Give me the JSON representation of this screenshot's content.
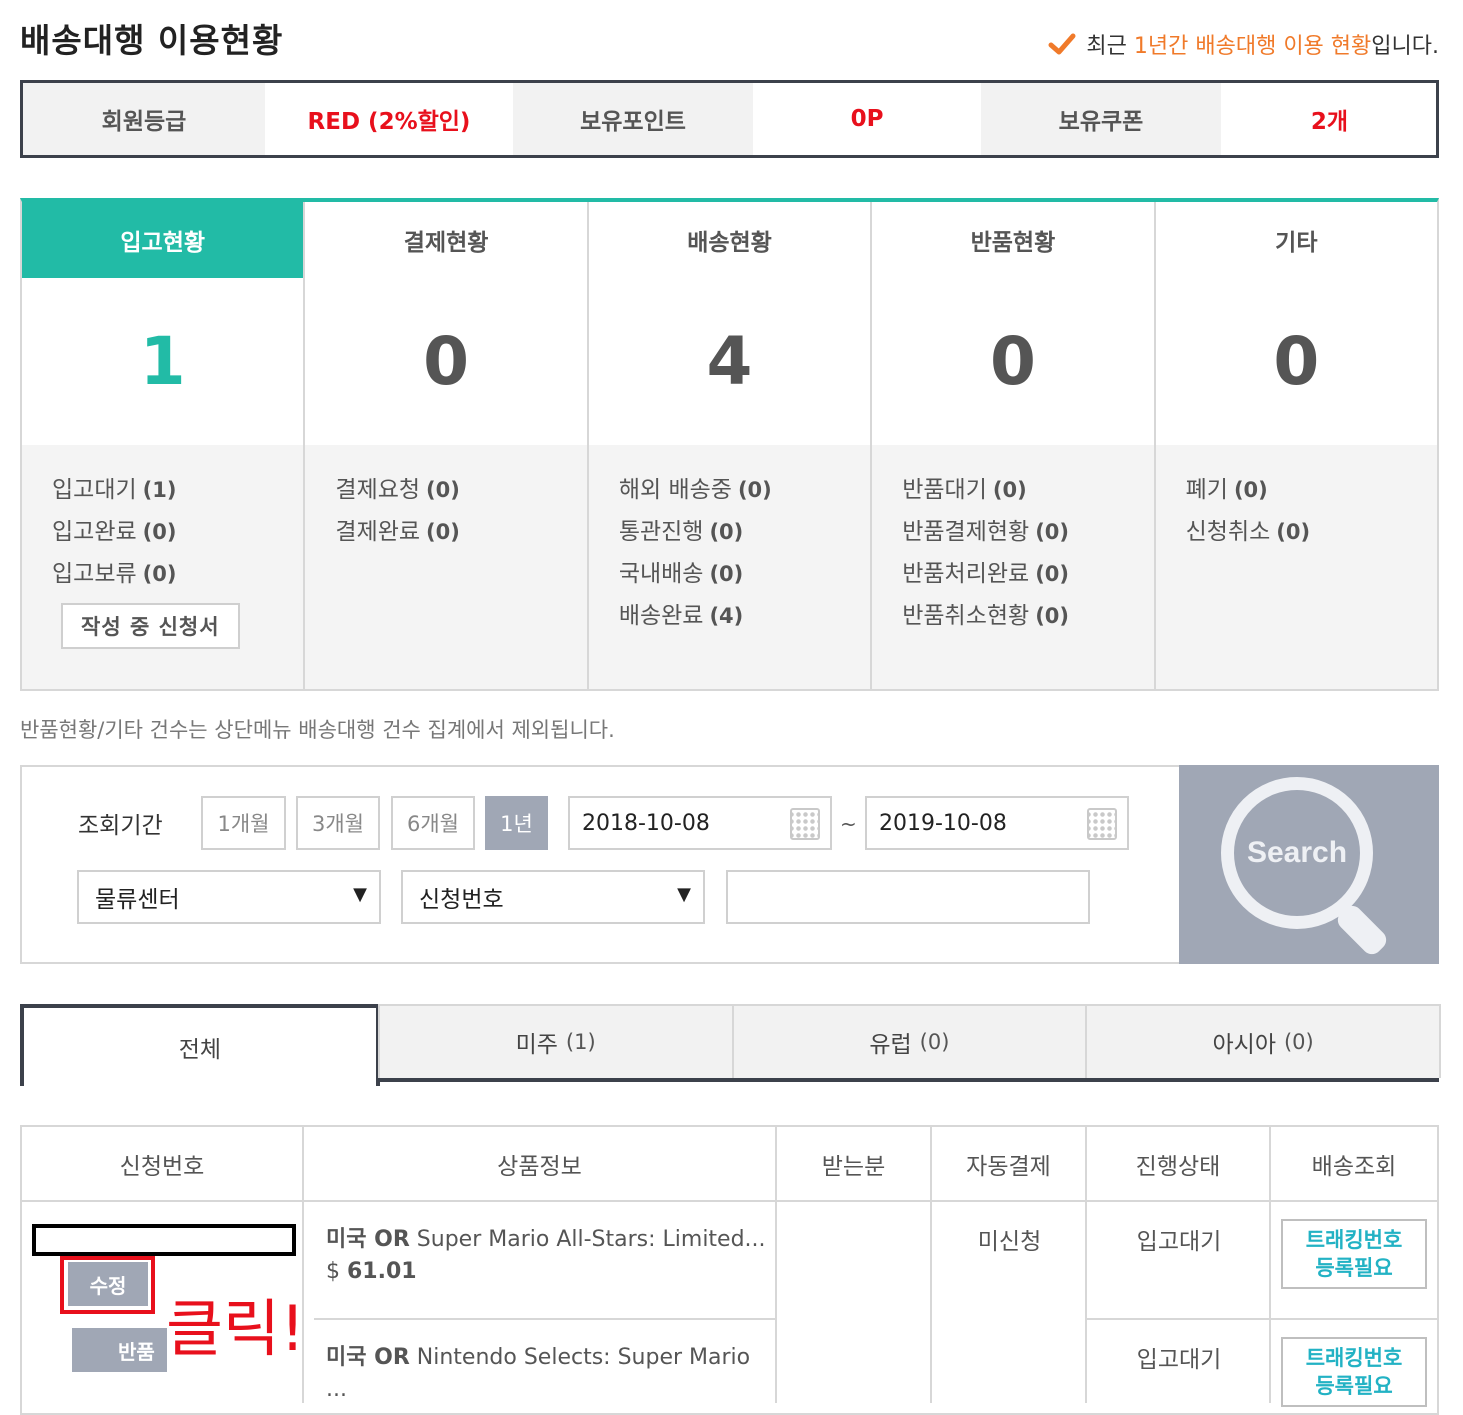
{
  "header": {
    "title": "배송대행 이용현황",
    "notice_prefix": "최근 ",
    "notice_highlight": "1년간 배송대행 이용 현황",
    "notice_suffix": "입니다."
  },
  "member": {
    "grade_label": "회원등급",
    "grade_value": "RED (2%할인)",
    "points_label": "보유포인트",
    "points_value": "0P",
    "coupons_label": "보유쿠폰",
    "coupons_value": "2개"
  },
  "status": {
    "columns": [
      {
        "title": "입고현황",
        "count": "1",
        "items": [
          {
            "label": "입고대기",
            "count": "(1)"
          },
          {
            "label": "입고완료",
            "count": "(0)"
          },
          {
            "label": "입고보류",
            "count": "(0)"
          }
        ]
      },
      {
        "title": "결제현황",
        "count": "0",
        "items": [
          {
            "label": "결제요청",
            "count": "(0)"
          },
          {
            "label": "결제완료",
            "count": "(0)"
          }
        ]
      },
      {
        "title": "배송현황",
        "count": "4",
        "items": [
          {
            "label": "해외 배송중",
            "count": "(0)"
          },
          {
            "label": "통관진행",
            "count": "(0)"
          },
          {
            "label": "국내배송",
            "count": "(0)"
          },
          {
            "label": "배송완료",
            "count": "(4)"
          }
        ]
      },
      {
        "title": "반품현황",
        "count": "0",
        "items": [
          {
            "label": "반품대기",
            "count": "(0)"
          },
          {
            "label": "반품결제현황",
            "count": "(0)"
          },
          {
            "label": "반품처리완료",
            "count": "(0)"
          },
          {
            "label": "반품취소현황",
            "count": "(0)"
          }
        ]
      },
      {
        "title": "기타",
        "count": "0",
        "items": [
          {
            "label": "폐기",
            "count": "(0)"
          },
          {
            "label": "신청취소",
            "count": "(0)"
          }
        ]
      }
    ],
    "draft_button": "작성 중 신청서",
    "footnote": "반품현황/기타 건수는 상단메뉴 배송대행 건수 집계에서 제외됩니다."
  },
  "search": {
    "period_label": "조회기간",
    "period_buttons": [
      "1개월",
      "3개월",
      "6개월",
      "1년"
    ],
    "active_period": "1년",
    "date_from": "2018-10-08",
    "date_sep": "~",
    "date_to": "2019-10-08",
    "center_select": "물류센터",
    "field_select": "신청번호",
    "keyword": "",
    "search_button": "Search"
  },
  "tabs": [
    {
      "label": "전체",
      "count": ""
    },
    {
      "label": "미주",
      "count": "(1)"
    },
    {
      "label": "유럽",
      "count": "(0)"
    },
    {
      "label": "아시아",
      "count": "(0)"
    }
  ],
  "table": {
    "headers": [
      "신청번호",
      "상품정보",
      "받는분",
      "자동결제",
      "진행상태",
      "배송조회"
    ],
    "edit_button": "수정",
    "return_button": "반품",
    "click_note": "클릭!",
    "auto_pay": "미신청",
    "products": [
      {
        "region": "미국 OR",
        "name": "Super Mario All-Stars: Limited...",
        "price_symbol": "$",
        "price": "61.01",
        "status": "입고대기",
        "tracking": "트래킹번호\n등록필요"
      },
      {
        "region": "미국 OR",
        "name": "Nintendo Selects: Super Mario ...",
        "price_symbol": "",
        "price": "",
        "status": "입고대기",
        "tracking": "트래킹번호\n등록필요"
      }
    ]
  },
  "colors": {
    "accent": "#22bba6",
    "highlight": "#f07a2a",
    "value_red": "#e8101c",
    "button_gray": "#a0a7b5",
    "tracking": "#22b2c4"
  }
}
